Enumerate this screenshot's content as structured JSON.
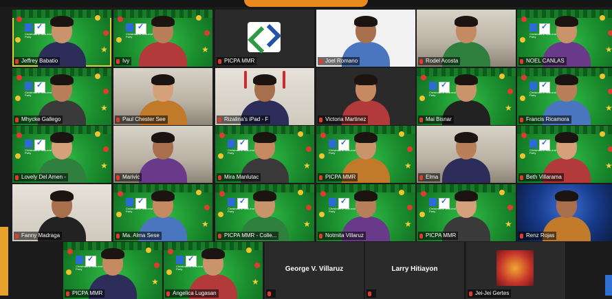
{
  "meeting": {
    "tiles": [
      {
        "name": "Jeffrey Babatio",
        "bg": "green",
        "active": true
      },
      {
        "name": "Ivy",
        "bg": "green"
      },
      {
        "name": "PICPA MMR",
        "bg": "dark",
        "center_logo": true
      },
      {
        "name": "Joel Romano",
        "bg": "white"
      },
      {
        "name": "Rodel Acosta",
        "bg": "office"
      },
      {
        "name": "NOEL CANLAS",
        "bg": "green"
      },
      {
        "name": "Mhycke Gallego",
        "bg": "green"
      },
      {
        "name": "Paul Chester See",
        "bg": "office"
      },
      {
        "name": "Rizalina's iPad - F",
        "bg": "wall",
        "antlers": true
      },
      {
        "name": "Victoria Martinez",
        "bg": "dark"
      },
      {
        "name": "Mai Bisnar",
        "bg": "green"
      },
      {
        "name": "Francis Ricamora",
        "bg": "green"
      },
      {
        "name": "Lovely Del Amen -",
        "bg": "green"
      },
      {
        "name": "Marivic",
        "bg": "office"
      },
      {
        "name": "Mira Manlutac",
        "bg": "green"
      },
      {
        "name": "PICPA MMR",
        "bg": "green"
      },
      {
        "name": "Elma",
        "bg": "office"
      },
      {
        "name": "Beth Villarama",
        "bg": "green"
      },
      {
        "name": "Fanny Madraga",
        "bg": "wall"
      },
      {
        "name": "Ma. Alma Sese",
        "bg": "green"
      },
      {
        "name": "PICPA MMR - Colle...",
        "bg": "green"
      },
      {
        "name": "Notmita Villaruz",
        "bg": "green"
      },
      {
        "name": "PICPA MMR",
        "bg": "green"
      },
      {
        "name": "Renz Rojas",
        "bg": "space"
      },
      {
        "name": "PICPA MMR",
        "bg": "green"
      },
      {
        "name": "Angelica Lugasan",
        "bg": "green"
      },
      {
        "name": "George V. Villaruz",
        "bg": "dark",
        "no_video": true
      },
      {
        "name": "Larry Hitiayon",
        "bg": "dark",
        "no_video": true
      },
      {
        "name": "Jei-Jei Gertes",
        "bg": "dark",
        "poster": true
      }
    ],
    "background_text": "Christmas & Year-end Party",
    "accent_color": "#e98a1e",
    "active_speaker_color": "#e2d23a",
    "icons": {
      "muted": "microphone-muted-icon"
    }
  }
}
